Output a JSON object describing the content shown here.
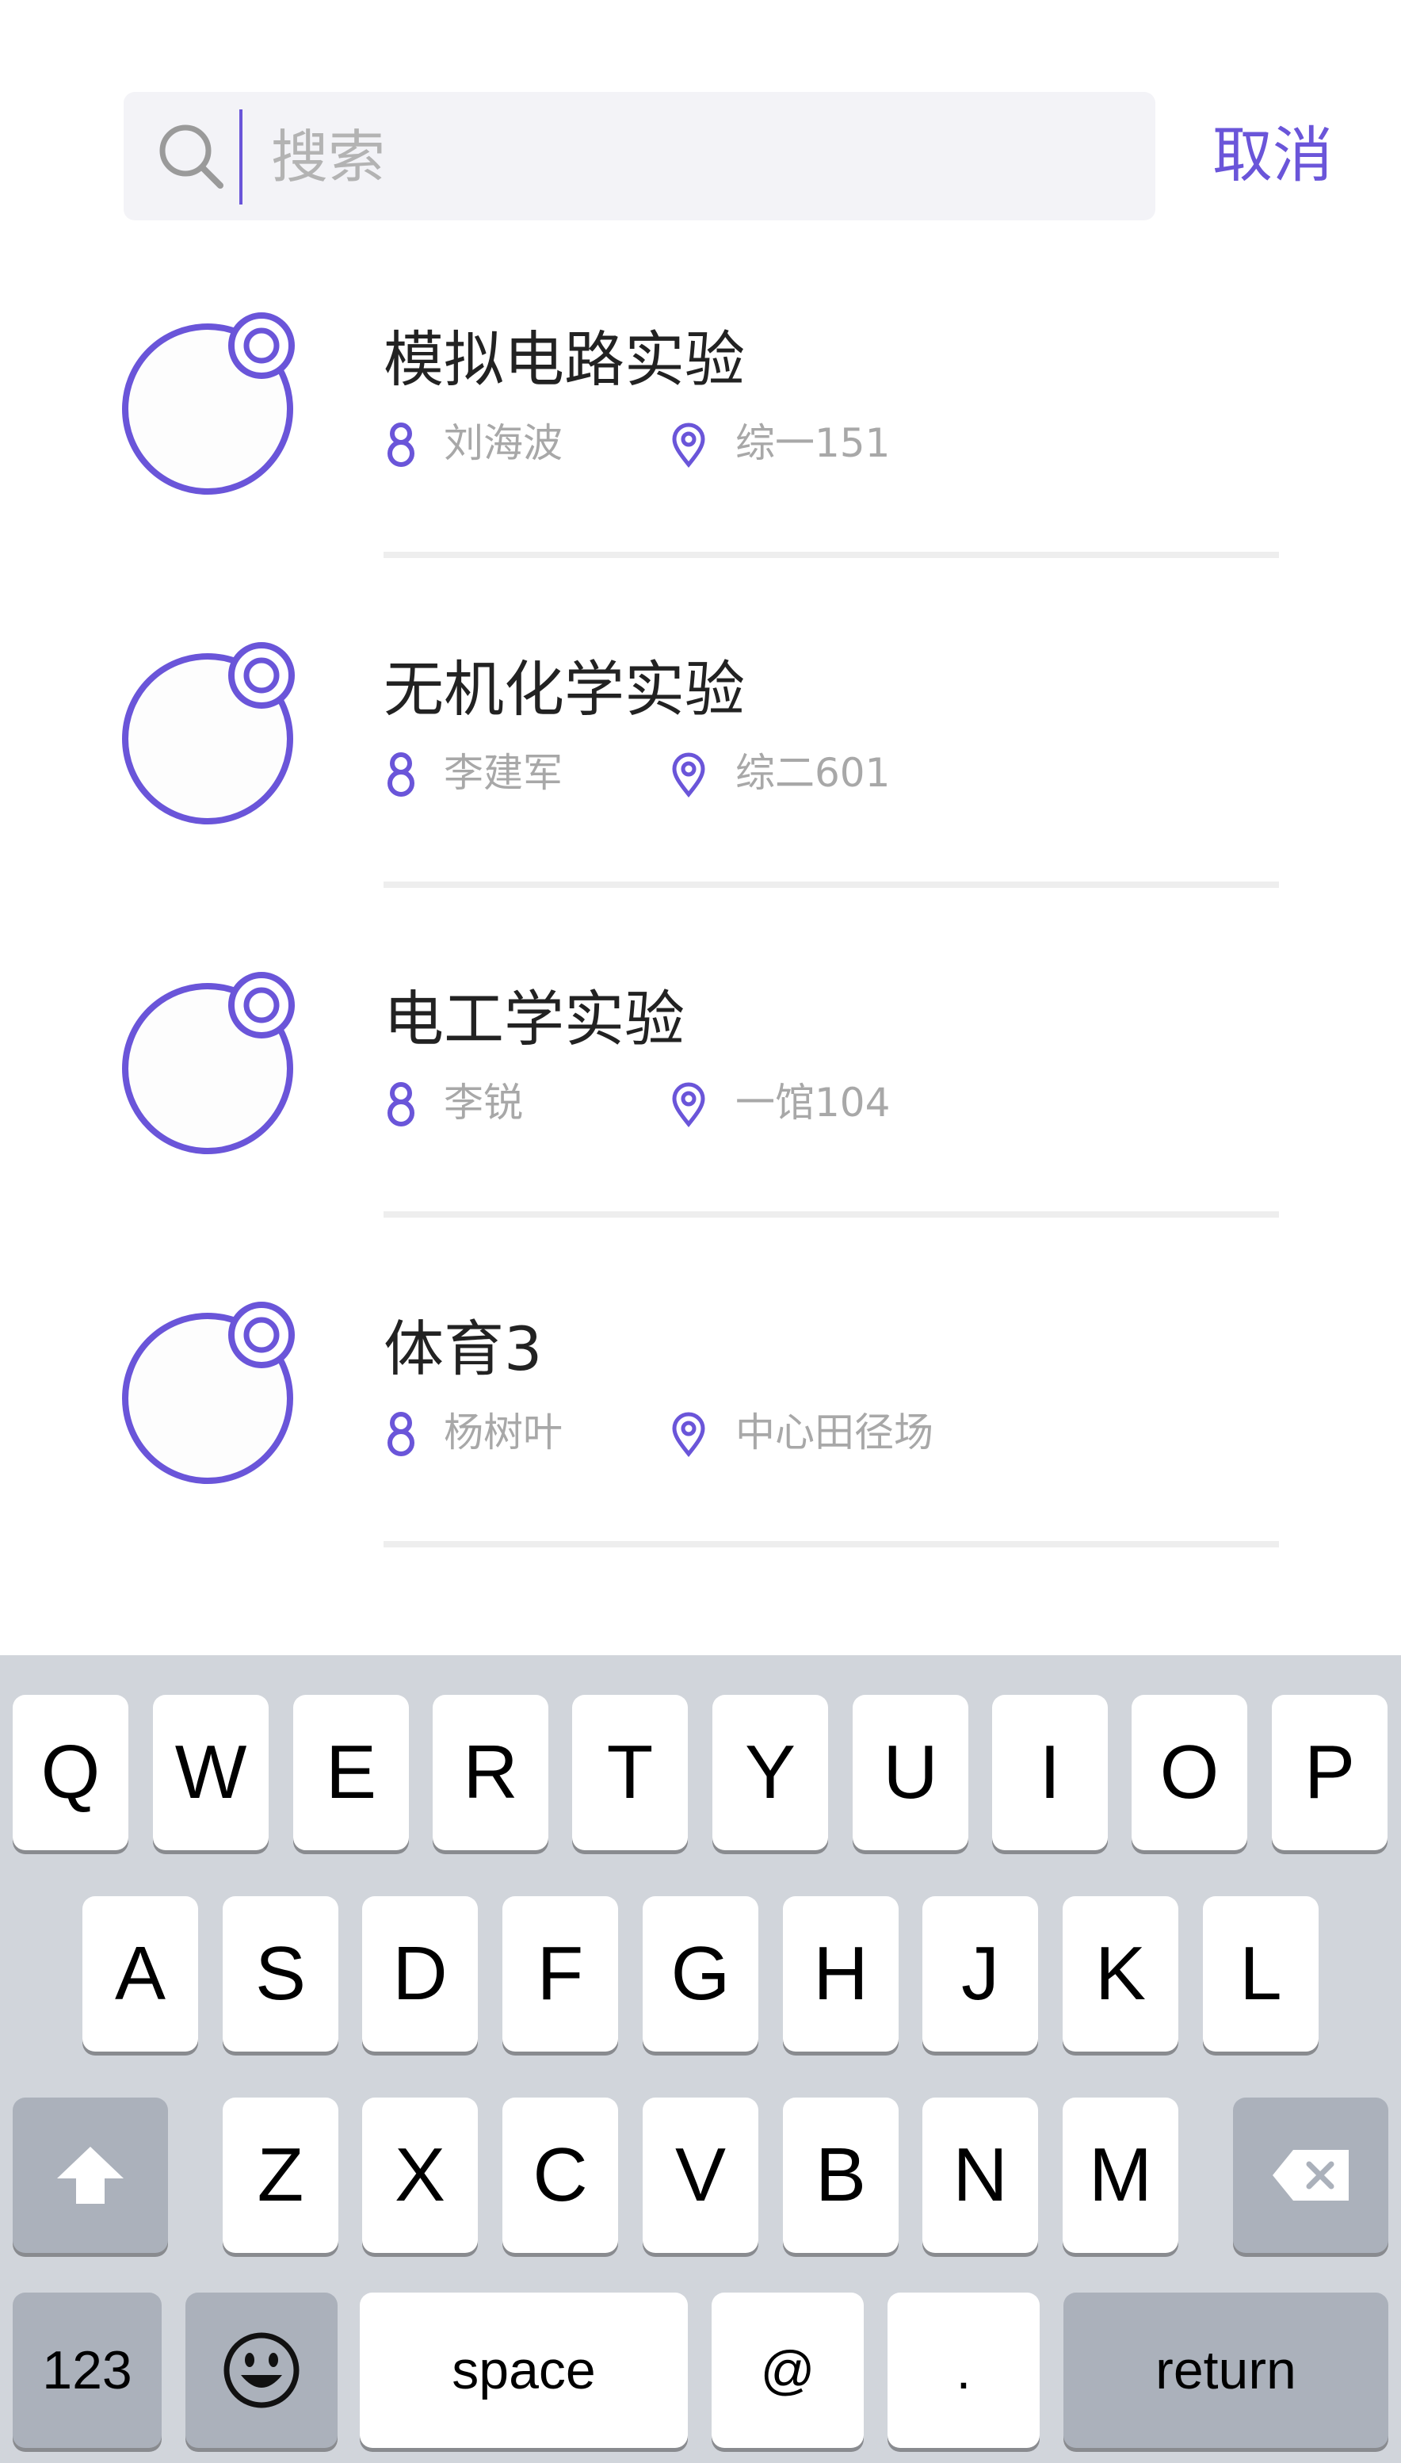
{
  "search": {
    "placeholder": "搜索",
    "value": "",
    "cancel_label": "取消"
  },
  "colors": {
    "accent": "#6a55d9",
    "search_bg": "#f3f3f7",
    "divider": "#eeeeee",
    "keyboard_bg": "#d1d5db",
    "key_dark": "#abb1bb"
  },
  "icons": {
    "search": "search-icon",
    "course": "flask-circle-icon",
    "teacher": "person-icon",
    "location": "location-pin-icon",
    "shift": "shift-arrow-icon",
    "delete": "backspace-icon",
    "emoji": "emoji-icon"
  },
  "courses": [
    {
      "name": "模拟电路实验",
      "teacher": "刘海波",
      "location": "综一151"
    },
    {
      "name": "无机化学实验",
      "teacher": "李建军",
      "location": "综二601"
    },
    {
      "name": "电工学实验",
      "teacher": "李锐",
      "location": "一馆104"
    },
    {
      "name": "体育3",
      "teacher": "杨树叶",
      "location": "中心田径场"
    }
  ],
  "keyboard": {
    "row1": [
      "Q",
      "W",
      "E",
      "R",
      "T",
      "Y",
      "U",
      "I",
      "O",
      "P"
    ],
    "row2": [
      "A",
      "S",
      "D",
      "F",
      "G",
      "H",
      "J",
      "K",
      "L"
    ],
    "row3": [
      "Z",
      "X",
      "C",
      "V",
      "B",
      "N",
      "M"
    ],
    "numbers_label": "123",
    "space_label": "space",
    "at_label": "@",
    "dot_label": ".",
    "return_label": "return"
  }
}
